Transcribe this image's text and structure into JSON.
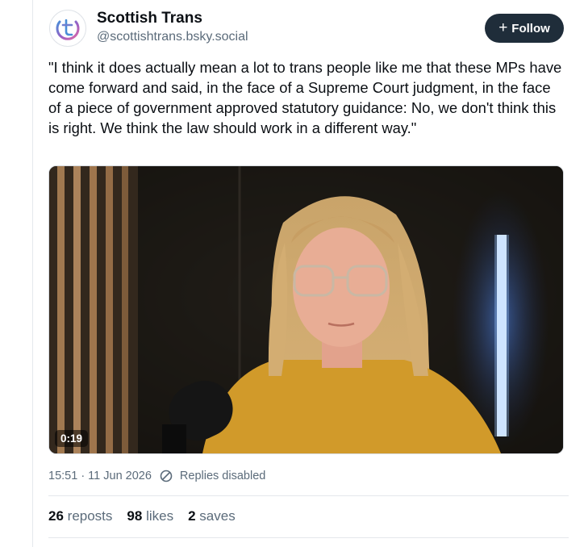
{
  "author": {
    "display_name": "Scottish Trans",
    "handle": "@scottishtrans.bsky.social",
    "avatar_icon": "scottish-trans-logo",
    "avatar_colors": [
      "#4a8ed8",
      "#9b5fc4",
      "#e36aa5"
    ]
  },
  "follow_button": {
    "label": "Follow",
    "icon": "plus-icon"
  },
  "post": {
    "text": "\"I think it does actually mean a lot to trans people like me that these MPs have come forward and said, in the face of a Supreme Court judgment, in the face of a piece of government approved statutory guidance: No, we don't think this is right. We think the law should work in a different way.\""
  },
  "video": {
    "duration": "0:19"
  },
  "meta": {
    "timestamp": "15:51 · 11 Jun 2026",
    "replies_status": "Replies disabled",
    "replies_icon": "no-entry-icon"
  },
  "stats": {
    "reposts_count": "26",
    "reposts_label": "reposts",
    "likes_count": "98",
    "likes_label": "likes",
    "saves_count": "2",
    "saves_label": "saves"
  },
  "colors": {
    "follow_bg": "#1f2d3a",
    "muted_text": "#5b6b7a"
  }
}
